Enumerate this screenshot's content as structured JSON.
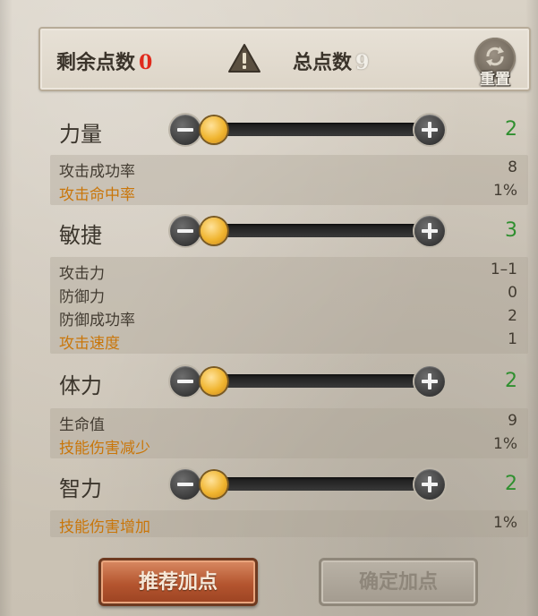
{
  "header": {
    "remaining_label": "剩余点数",
    "remaining_value": "0",
    "total_label": "总点数",
    "total_value": "9",
    "warning_icon": "warning-triangle-icon",
    "reset_label": "重置",
    "reset_icon": "refresh-icon"
  },
  "attributes": [
    {
      "label": "力量",
      "value": "2",
      "slider_fraction": 0.0,
      "details": [
        {
          "key": "攻击成功率",
          "value": "8",
          "highlight": false
        },
        {
          "key": "攻击命中率",
          "value": "1%",
          "highlight": true
        }
      ]
    },
    {
      "label": "敏捷",
      "value": "3",
      "slider_fraction": 0.0,
      "details": [
        {
          "key": "攻击力",
          "value": "1–1",
          "highlight": false
        },
        {
          "key": "防御力",
          "value": "0",
          "highlight": false
        },
        {
          "key": "防御成功率",
          "value": "2",
          "highlight": false
        },
        {
          "key": "攻击速度",
          "value": "1",
          "highlight": true
        }
      ]
    },
    {
      "label": "体力",
      "value": "2",
      "slider_fraction": 0.0,
      "details": [
        {
          "key": "生命值",
          "value": "9",
          "highlight": false
        },
        {
          "key": "技能伤害减少",
          "value": "1%",
          "highlight": true
        }
      ]
    },
    {
      "label": "智力",
      "value": "2",
      "slider_fraction": 0.0,
      "details": [
        {
          "key": "技能伤害增加",
          "value": "1%",
          "highlight": true
        }
      ]
    }
  ],
  "buttons": {
    "recommend_label": "推荐加点",
    "confirm_label": "确定加点"
  },
  "colors": {
    "remaining_value": "#e02a1c",
    "attr_value": "#2f8f2f",
    "highlight_text": "#c9760a",
    "recommend_button": "#b4552f"
  }
}
